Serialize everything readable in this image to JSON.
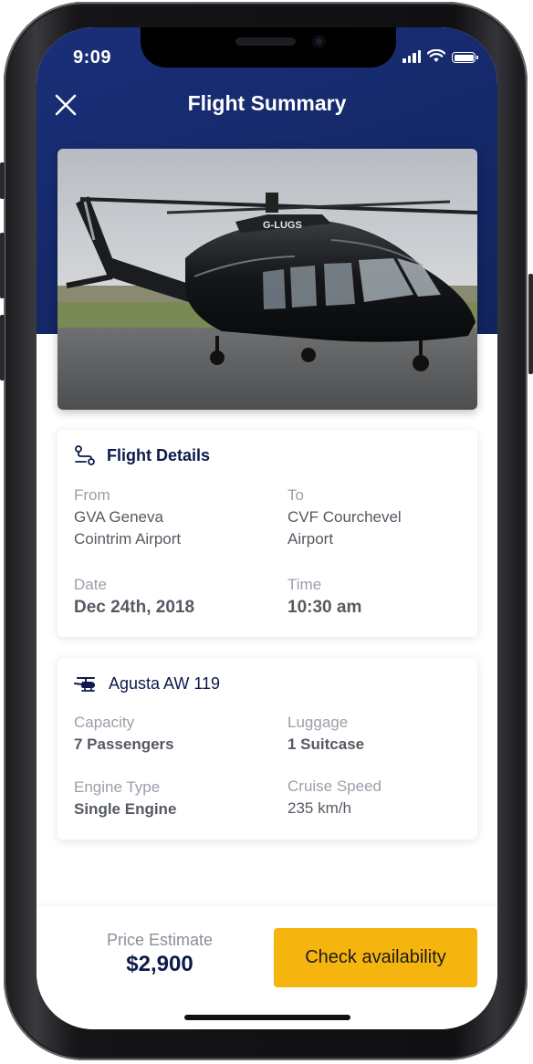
{
  "status_bar": {
    "time": "9:09",
    "icons": [
      "signal-icon",
      "wifi-icon",
      "battery-icon"
    ]
  },
  "header": {
    "title": "Flight Summary",
    "close_icon": "close-icon"
  },
  "hero": {
    "registration": "G-LUGS"
  },
  "flight_details": {
    "title": "Flight Details",
    "icon": "route-icon",
    "from_label": "From",
    "from_line1": "GVA Geneva",
    "from_line2": "Cointrim Airport",
    "to_label": "To",
    "to_line1": "CVF Courchevel",
    "to_line2": "Airport",
    "date_label": "Date",
    "date_value": "Dec 24th, 2018",
    "time_label": "Time",
    "time_value": "10:30 am"
  },
  "aircraft": {
    "name": "Agusta AW 119",
    "icon": "helicopter-icon",
    "capacity_label": "Capacity",
    "capacity_value": "7 Passengers",
    "luggage_label": "Luggage",
    "luggage_value": "1 Suitcase",
    "engine_label": "Engine Type",
    "engine_value": "Single Engine",
    "speed_label": "Cruise Speed",
    "speed_value": "235 km/h"
  },
  "footer": {
    "price_label": "Price Estimate",
    "price_value": "$2,900",
    "cta_label": "Check availability"
  },
  "colors": {
    "header_bg": "#142868",
    "accent": "#f5b50e",
    "title_text": "#0d1a4a"
  }
}
